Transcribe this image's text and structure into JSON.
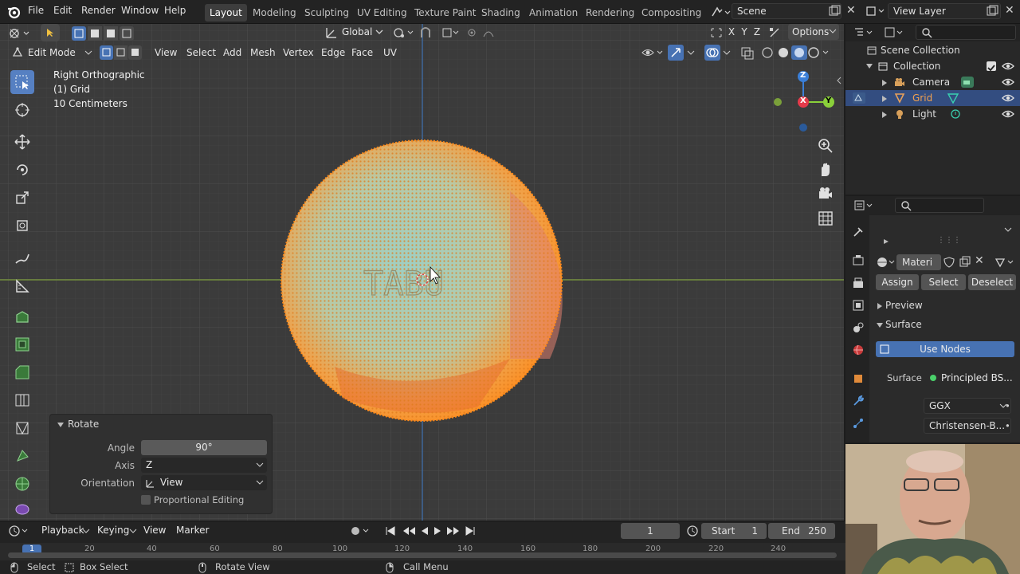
{
  "app": {
    "accent": "#4772b3",
    "background": "#1d1d1d"
  },
  "topbar": {
    "menus": [
      "File",
      "Edit",
      "Render",
      "Window",
      "Help"
    ],
    "workspaces": [
      "Layout",
      "Modeling",
      "Sculpting",
      "UV Editing",
      "Texture Paint",
      "Shading",
      "Animation",
      "Rendering",
      "Compositing"
    ],
    "active_workspace": "Layout",
    "scene_name": "Scene",
    "view_layer": "View Layer"
  },
  "viewport": {
    "mode": "Edit Mode",
    "menus": [
      "View",
      "Select",
      "Add",
      "Mesh",
      "Vertex",
      "Edge",
      "Face",
      "UV"
    ],
    "transform_orientation": "Global",
    "options_label": "Options",
    "axis_letters": [
      "X",
      "Y",
      "Z"
    ],
    "overlay": {
      "view_name": "Right Orthographic",
      "object_name": "(1) Grid",
      "scale": "10 Centimeters"
    },
    "gizmo": {
      "x": "X",
      "y": "Y",
      "z": "Z"
    },
    "toolbar_icons": [
      "select-box-icon",
      "cursor-icon",
      "move-icon",
      "rotate-icon",
      "scale-icon",
      "transform-icon",
      "annotate-icon",
      "measure-icon",
      "extrude-icon",
      "inset-icon",
      "bevel-icon",
      "loop-cut-icon",
      "knife-icon",
      "poly-build-icon",
      "spin-icon",
      "smooth-icon"
    ]
  },
  "operator_panel": {
    "title": "Rotate",
    "angle_label": "Angle",
    "angle_value": "90°",
    "axis_label": "Axis",
    "axis_value": "Z",
    "orientation_label": "Orientation",
    "orientation_value": "View",
    "proportional_label": "Proportional Editing"
  },
  "outliner": {
    "root": "Scene Collection",
    "collection": "Collection",
    "items": [
      {
        "name": "Camera",
        "color": "#d8a05a"
      },
      {
        "name": "Grid",
        "color": "#e8a05a",
        "selected": true
      },
      {
        "name": "Light",
        "color": "#d8a05a"
      }
    ]
  },
  "properties": {
    "material_name": "Materi",
    "assign": "Assign",
    "select": "Select",
    "deselect": "Deselect",
    "preview": "Preview",
    "surface_header": "Surface",
    "use_nodes": "Use Nodes",
    "surface_label": "Surface",
    "surface_value": "Principled BS...",
    "distribution": "GGX",
    "subsurface": "Christensen-B..."
  },
  "timeline": {
    "menus": [
      "Playback",
      "Keying",
      "View",
      "Marker"
    ],
    "current_frame": "1",
    "start_label": "Start",
    "start_value": "1",
    "end_label": "End",
    "end_value": "250",
    "ruler": [
      "1",
      "20",
      "40",
      "60",
      "80",
      "100",
      "120",
      "140",
      "160",
      "180",
      "200",
      "220",
      "240"
    ]
  },
  "statusbar": {
    "select": "Select",
    "box_select": "Box Select",
    "rotate_view": "Rotate View",
    "call_menu": "Call Menu"
  }
}
